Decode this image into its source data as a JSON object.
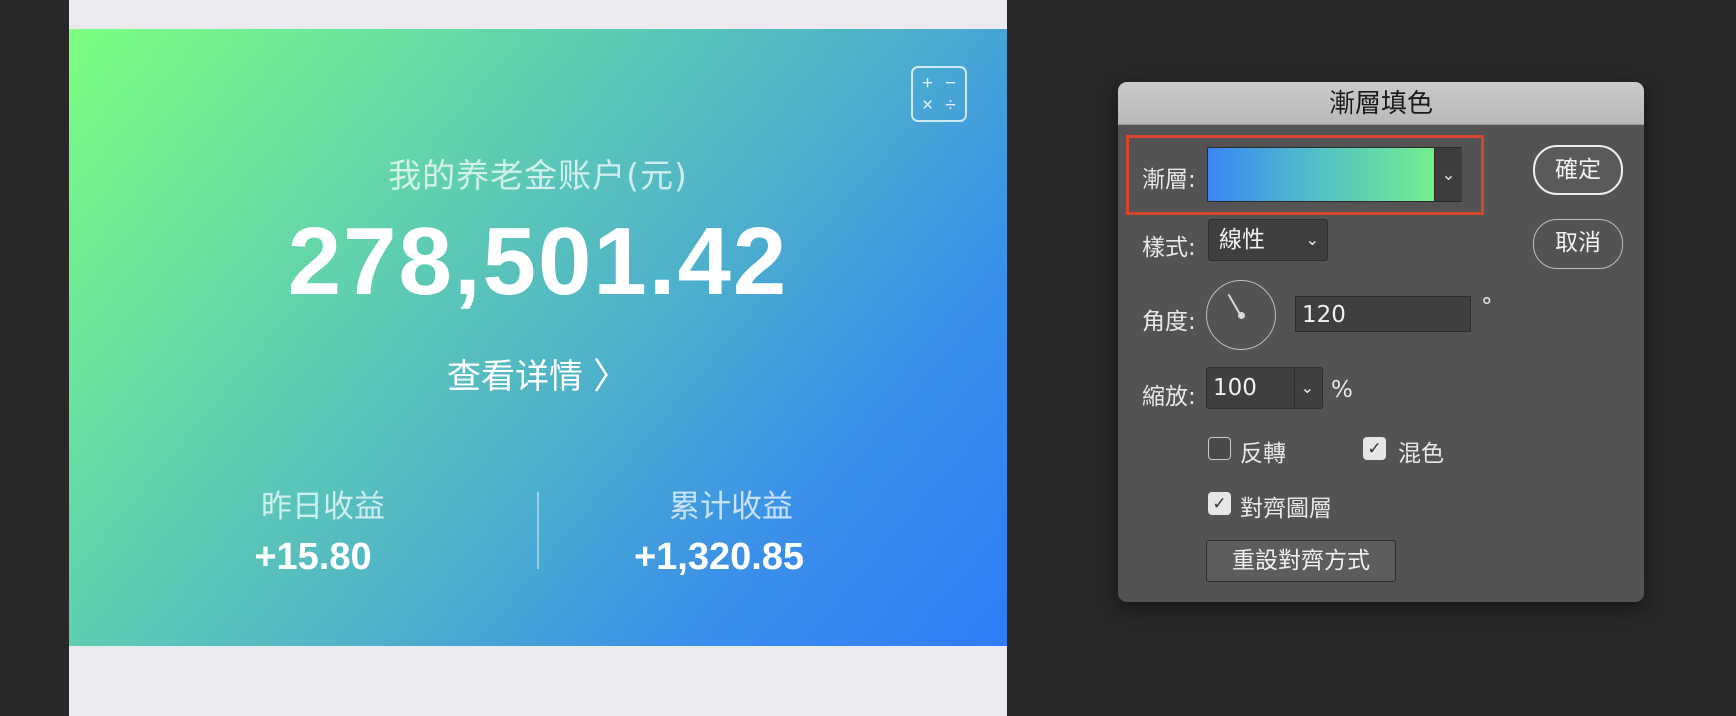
{
  "app_card": {
    "calc_icon": [
      "+",
      "−",
      "×",
      "÷"
    ],
    "account_title": "我的养老金账户(元)",
    "balance": "278,501.42",
    "details_link": "查看详情",
    "details_chevron": "〉",
    "yesterday_label": "昨日收益",
    "yesterday_value": "+15.80",
    "cumulative_label": "累计收益",
    "cumulative_value": "+1,320.85",
    "gradient_colors": [
      "#7dff80",
      "#2f7cf8"
    ]
  },
  "dialog": {
    "title": "漸層填色",
    "gradient_label": "漸層:",
    "gradient_swatch_colors": [
      "#3a86f5",
      "#7df880"
    ],
    "style_label": "樣式:",
    "style_value": "線性",
    "angle_label": "角度:",
    "angle_value": "120",
    "angle_unit": "°",
    "scale_label": "縮放:",
    "scale_value": "100",
    "scale_unit": "%",
    "reverse_label": "反轉",
    "reverse_checked": false,
    "dither_label": "混色",
    "dither_checked": true,
    "align_label": "對齊圖層",
    "align_checked": true,
    "reset_align_button": "重設對齊方式",
    "ok_button": "確定",
    "cancel_button": "取消"
  }
}
